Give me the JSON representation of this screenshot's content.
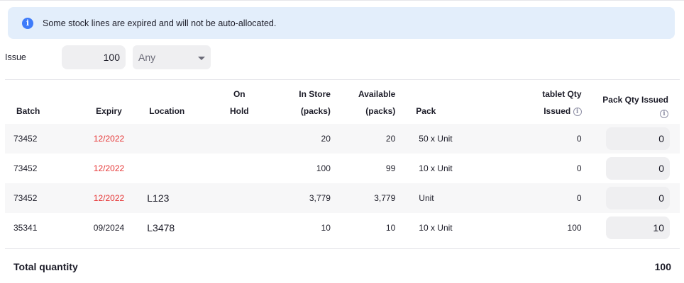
{
  "alert": {
    "icon": "info-icon",
    "message": "Some stock lines are expired and will not be auto-allocated."
  },
  "issue": {
    "label": "Issue",
    "quantity": "100",
    "unit_select": "Any"
  },
  "table": {
    "headers": {
      "batch": "Batch",
      "expiry": "Expiry",
      "location": "Location",
      "on_hold_1": "On",
      "on_hold_2": "Hold",
      "in_store_1": "In Store",
      "in_store_2": "(packs)",
      "available_1": "Available",
      "available_2": "(packs)",
      "pack": "Pack",
      "tablet_qty_1": "tablet Qty",
      "tablet_qty_2": "Issued",
      "pack_qty": "Pack Qty Issued"
    },
    "rows": [
      {
        "batch": "73452",
        "expiry": "12/2022",
        "expired": true,
        "location": "",
        "on_hold": "",
        "in_store": "20",
        "available": "20",
        "pack": "50 x Unit",
        "tablet_qty": "0",
        "pack_qty": "0"
      },
      {
        "batch": "73452",
        "expiry": "12/2022",
        "expired": true,
        "location": "",
        "on_hold": "",
        "in_store": "100",
        "available": "99",
        "pack": "10 x Unit",
        "tablet_qty": "0",
        "pack_qty": "0"
      },
      {
        "batch": "73452",
        "expiry": "12/2022",
        "expired": true,
        "location": "L123",
        "on_hold": "",
        "in_store": "3,779",
        "available": "3,779",
        "pack": "Unit",
        "tablet_qty": "0",
        "pack_qty": "0"
      },
      {
        "batch": "35341",
        "expiry": "09/2024",
        "expired": false,
        "location": "L3478",
        "on_hold": "",
        "in_store": "10",
        "available": "10",
        "pack": "10 x Unit",
        "tablet_qty": "100",
        "pack_qty": "10"
      }
    ]
  },
  "total": {
    "label": "Total quantity",
    "value": "100"
  },
  "colors": {
    "expired": "#e63535",
    "alert_bg": "#e3eefb",
    "info": "#3e7bfa"
  }
}
